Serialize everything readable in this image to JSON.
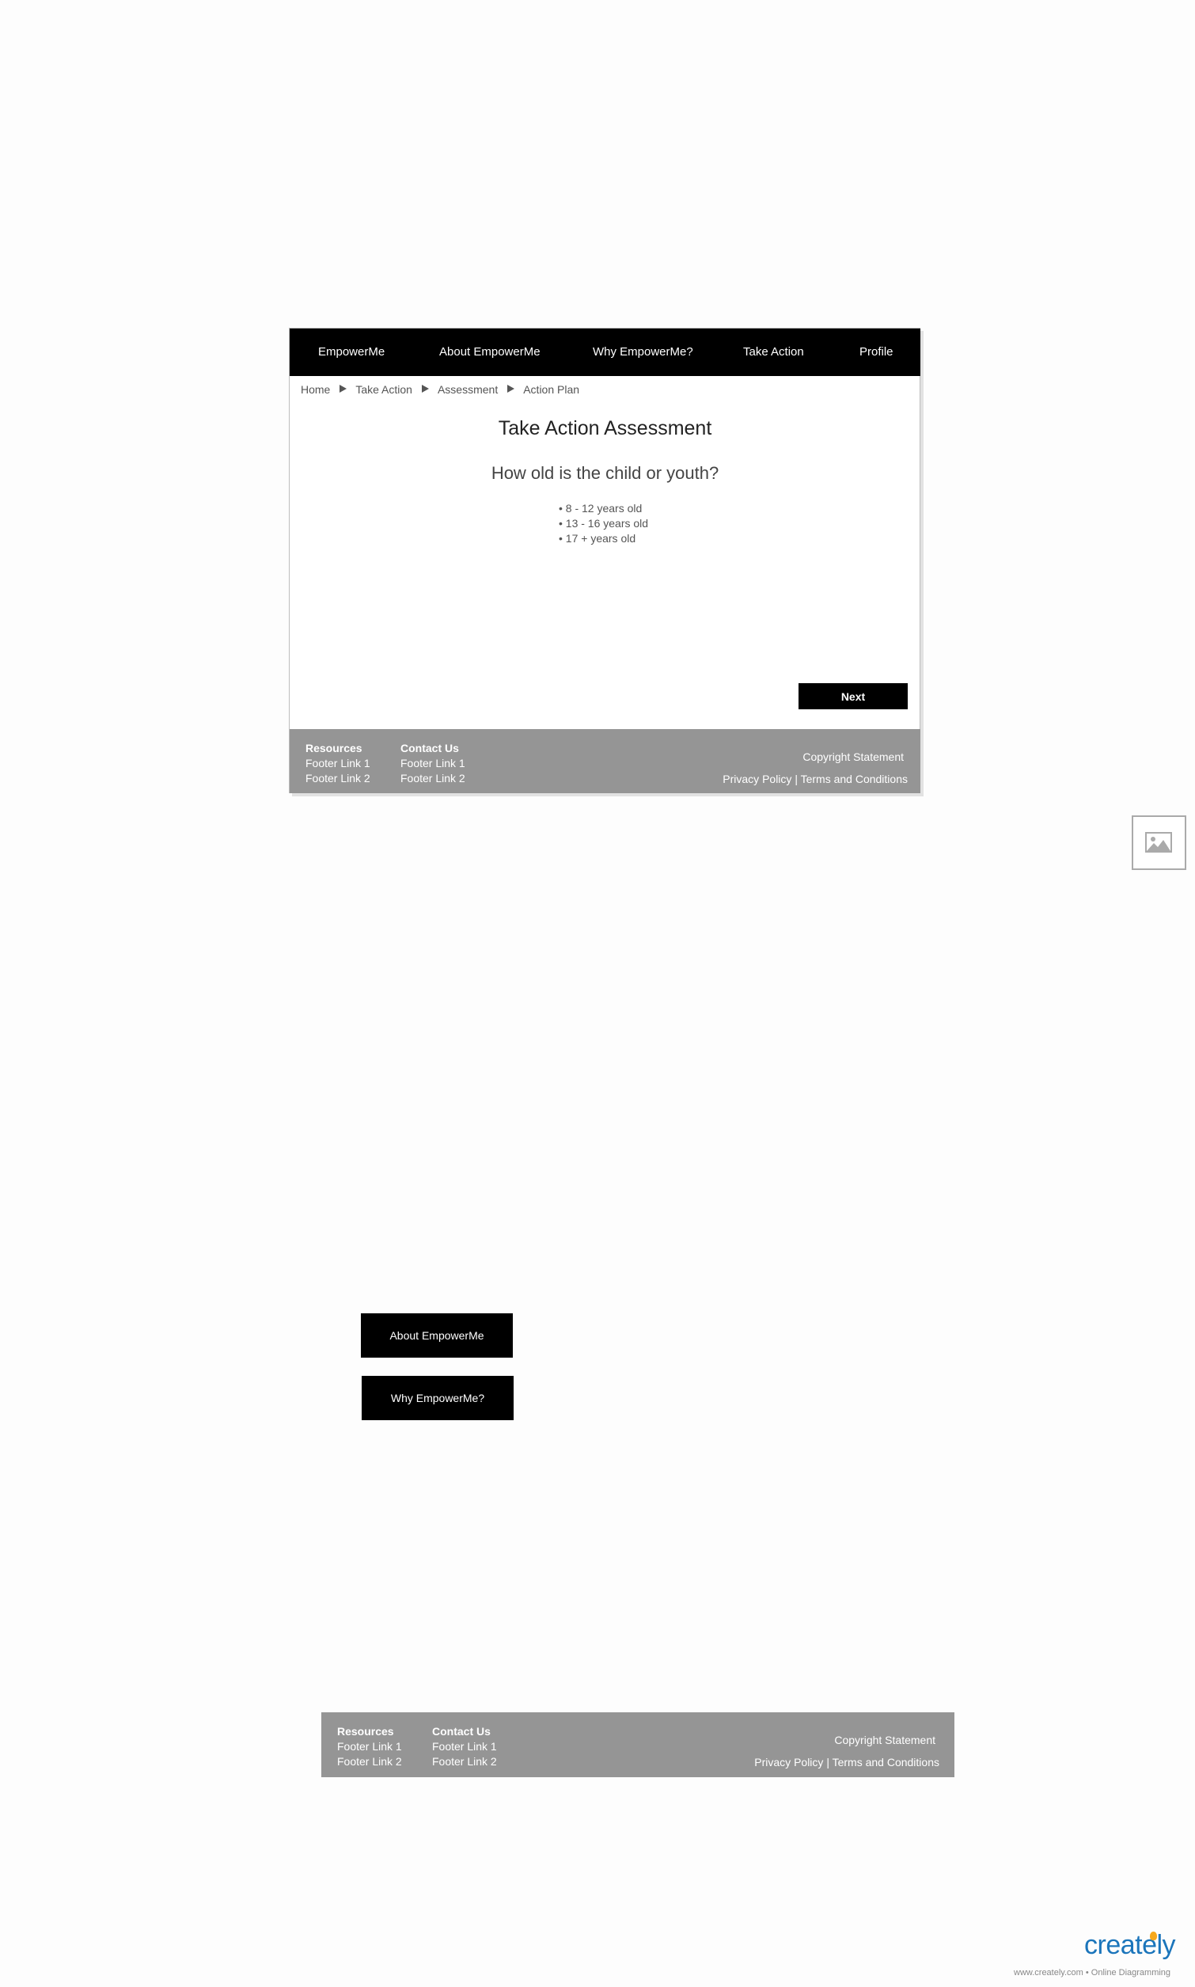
{
  "nav": {
    "items": [
      {
        "label": "EmpowerMe"
      },
      {
        "label": "About EmpowerMe"
      },
      {
        "label": "Why EmpowerMe?"
      },
      {
        "label": "Take Action"
      },
      {
        "label": "Profile"
      }
    ]
  },
  "breadcrumb": [
    "Home",
    "Take Action",
    "Assessment",
    "Action Plan"
  ],
  "main": {
    "title": "Take Action Assessment",
    "question": "How old is the child or youth?",
    "options": [
      "• 8 - 12 years old",
      "• 13 - 16 years old",
      "• 17 + years old"
    ],
    "next_label": "Next"
  },
  "footer": {
    "col1_title": "Resources",
    "col1_links": [
      "Footer Link 1",
      "Footer Link 2"
    ],
    "col2_title": "Contact Us",
    "col2_links": [
      "Footer Link 1",
      "Footer Link 2"
    ],
    "copyright": "Copyright Statement",
    "privacy": "Privacy Policy",
    "divider": "|",
    "terms": "Terms and Conditions"
  },
  "standalone_buttons": [
    "About EmpowerMe",
    "Why EmpowerMe?"
  ],
  "watermark": {
    "logo": "creately",
    "text": "www.creately.com • Online Diagramming"
  },
  "colors": {
    "nav_bg": "#000000",
    "footer_bg": "#959595",
    "button_bg": "#000000",
    "logo": "#1b75bb",
    "logo_accent": "#f6a81c"
  }
}
